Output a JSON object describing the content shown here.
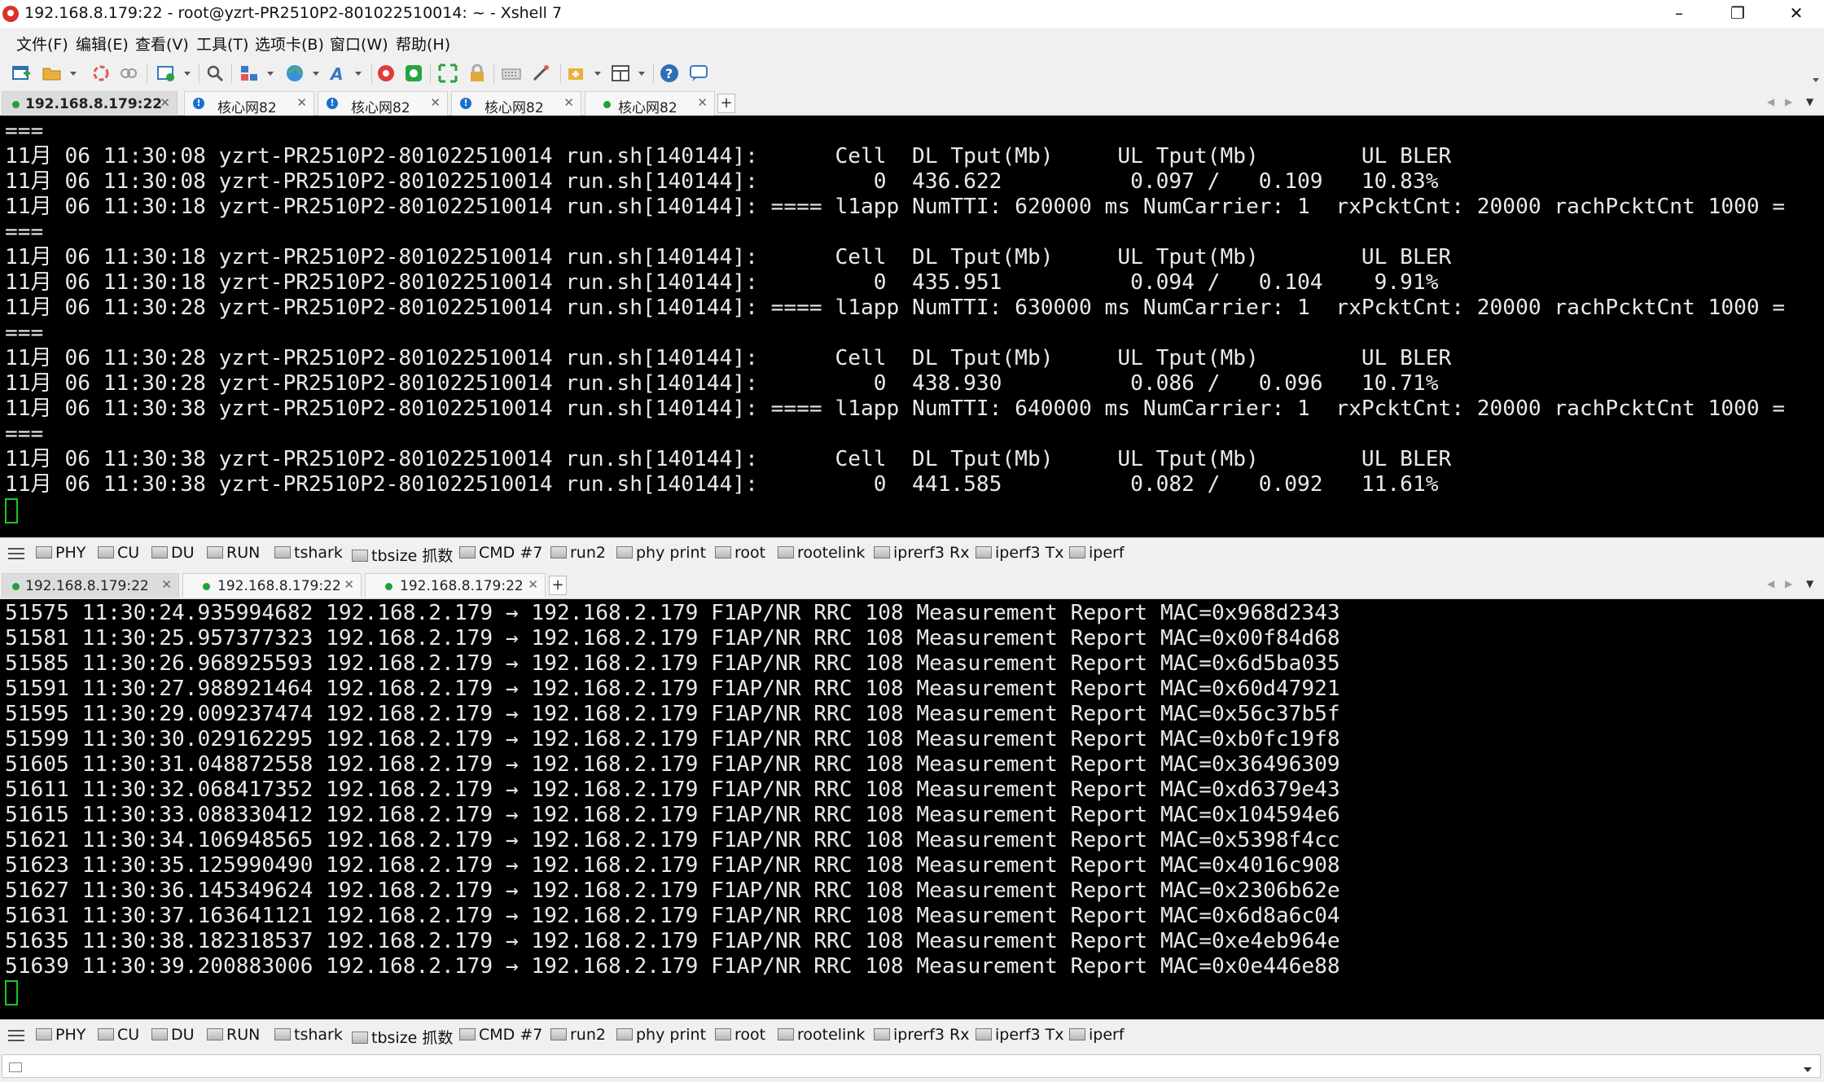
{
  "window": {
    "title": "192.168.8.179:22 - root@yzrt-PR2510P2-801022510014: ~ - Xshell 7",
    "minimize_glyph": "–",
    "maximize_glyph": "❐",
    "close_glyph": "✕"
  },
  "menu": [
    "文件(F)",
    "编辑(E)",
    "查看(V)",
    "工具(T)",
    "选项卡(B)",
    "窗口(W)",
    "帮助(H)"
  ],
  "toolbar_icons": [
    "new-session-icon",
    "open-folder-icon",
    "reconnect-icon",
    "disconnect-icon",
    "properties-icon",
    "search-icon",
    "transfer-icon",
    "globe-icon",
    "font-icon",
    "xftp-icon",
    "xmanager-icon",
    "fullscreen-icon",
    "lock-icon",
    "keyboard-icon",
    "script-icon",
    "add-panel-icon",
    "layout-icon",
    "help-icon",
    "chat-icon"
  ],
  "top_tabs": [
    {
      "label": "192.168.8.179:22",
      "status": "connected",
      "active": true
    },
    {
      "label": "核心网82",
      "status": "info",
      "active": false
    },
    {
      "label": "核心网82",
      "status": "info",
      "active": false
    },
    {
      "label": "核心网82",
      "status": "info",
      "active": false
    },
    {
      "label": "核心网82",
      "status": "connected",
      "active": false
    }
  ],
  "top_terminal": {
    "lines": [
      "===",
      "11月 06 11:30:08 yzrt-PR2510P2-801022510014 run.sh[140144]:      Cell  DL Tput(Mb)     UL Tput(Mb)        UL BLER",
      "11月 06 11:30:08 yzrt-PR2510P2-801022510014 run.sh[140144]:         0  436.622          0.097 /   0.109   10.83%",
      "11月 06 11:30:18 yzrt-PR2510P2-801022510014 run.sh[140144]: ==== l1app NumTTI: 620000 ms NumCarrier: 1  rxPcktCnt: 20000 rachPcktCnt 1000 =",
      "===",
      "11月 06 11:30:18 yzrt-PR2510P2-801022510014 run.sh[140144]:      Cell  DL Tput(Mb)     UL Tput(Mb)        UL BLER",
      "11月 06 11:30:18 yzrt-PR2510P2-801022510014 run.sh[140144]:         0  435.951          0.094 /   0.104    9.91%",
      "11月 06 11:30:28 yzrt-PR2510P2-801022510014 run.sh[140144]: ==== l1app NumTTI: 630000 ms NumCarrier: 1  rxPcktCnt: 20000 rachPcktCnt 1000 =",
      "===",
      "11月 06 11:30:28 yzrt-PR2510P2-801022510014 run.sh[140144]:      Cell  DL Tput(Mb)     UL Tput(Mb)        UL BLER",
      "11月 06 11:30:28 yzrt-PR2510P2-801022510014 run.sh[140144]:         0  438.930          0.086 /   0.096   10.71%",
      "11月 06 11:30:38 yzrt-PR2510P2-801022510014 run.sh[140144]: ==== l1app NumTTI: 640000 ms NumCarrier: 1  rxPcktCnt: 20000 rachPcktCnt 1000 =",
      "===",
      "11月 06 11:30:38 yzrt-PR2510P2-801022510014 run.sh[140144]:      Cell  DL Tput(Mb)     UL Tput(Mb)        UL BLER",
      "11月 06 11:30:38 yzrt-PR2510P2-801022510014 run.sh[140144]:         0  441.585          0.082 /   0.092   11.61%"
    ]
  },
  "quick_commands": [
    "PHY",
    "CU",
    "DU",
    "RUN",
    "tshark",
    "tbsize 抓数",
    "CMD #7",
    "run2",
    "phy print",
    "root",
    "rootelink",
    "iprerf3 Rx",
    "iperf3 Tx",
    "iperf"
  ],
  "bottom_tabs": [
    {
      "label": "192.168.8.179:22",
      "status": "connected",
      "active": true
    },
    {
      "label": "192.168.8.179:22",
      "status": "connected",
      "active": false
    },
    {
      "label": "192.168.8.179:22",
      "status": "connected",
      "active": false
    }
  ],
  "bottom_terminal": {
    "lines": [
      "51575 11:30:24.935994682 192.168.2.179 → 192.168.2.179 F1AP/NR RRC 108 Measurement Report MAC=0x968d2343",
      "51581 11:30:25.957377323 192.168.2.179 → 192.168.2.179 F1AP/NR RRC 108 Measurement Report MAC=0x00f84d68",
      "51585 11:30:26.968925593 192.168.2.179 → 192.168.2.179 F1AP/NR RRC 108 Measurement Report MAC=0x6d5ba035",
      "51591 11:30:27.988921464 192.168.2.179 → 192.168.2.179 F1AP/NR RRC 108 Measurement Report MAC=0x60d47921",
      "51595 11:30:29.009237474 192.168.2.179 → 192.168.2.179 F1AP/NR RRC 108 Measurement Report MAC=0x56c37b5f",
      "51599 11:30:30.029162295 192.168.2.179 → 192.168.2.179 F1AP/NR RRC 108 Measurement Report MAC=0xb0fc19f8",
      "51605 11:30:31.048872558 192.168.2.179 → 192.168.2.179 F1AP/NR RRC 108 Measurement Report MAC=0x36496309",
      "51611 11:30:32.068417352 192.168.2.179 → 192.168.2.179 F1AP/NR RRC 108 Measurement Report MAC=0xd6379e43",
      "51615 11:30:33.088330412 192.168.2.179 → 192.168.2.179 F1AP/NR RRC 108 Measurement Report MAC=0x104594e6",
      "51621 11:30:34.106948565 192.168.2.179 → 192.168.2.179 F1AP/NR RRC 108 Measurement Report MAC=0x5398f4cc",
      "51623 11:30:35.125990490 192.168.2.179 → 192.168.2.179 F1AP/NR RRC 108 Measurement Report MAC=0x4016c908",
      "51627 11:30:36.145349624 192.168.2.179 → 192.168.2.179 F1AP/NR RRC 108 Measurement Report MAC=0x2306b62e",
      "51631 11:30:37.163641121 192.168.2.179 → 192.168.2.179 F1AP/NR RRC 108 Measurement Report MAC=0x6d8a6c04",
      "51635 11:30:38.182318537 192.168.2.179 → 192.168.2.179 F1AP/NR RRC 108 Measurement Report MAC=0xe4eb964e",
      "51639 11:30:39.200883006 192.168.2.179 → 192.168.2.179 F1AP/NR RRC 108 Measurement Report MAC=0x0e446e88"
    ]
  },
  "colors": {
    "terminal_bg": "#000000",
    "terminal_fg": "#e9e9e9",
    "cursor": "#18c82b",
    "connected_dot": "#1fa13b",
    "info_badge": "#1a6fd0"
  }
}
